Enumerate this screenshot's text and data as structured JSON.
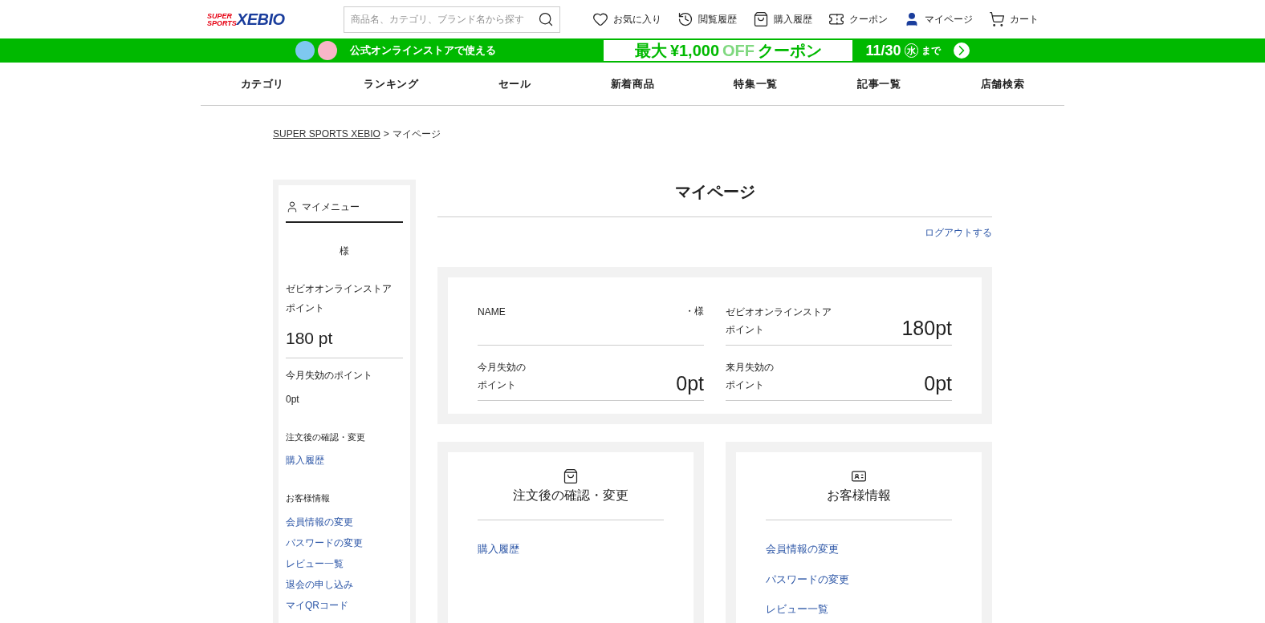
{
  "header": {
    "logo_top": "SUPER",
    "logo_bottom": "SPORTS",
    "logo_brand": "XEBIO",
    "search": {
      "placeholder": "商品名、カテゴリ、ブランド名から探す"
    },
    "links": [
      {
        "kind": "heart",
        "label": "お気に入り"
      },
      {
        "kind": "history",
        "label": "閲覧履歴"
      },
      {
        "kind": "bag",
        "label": "購入履歴"
      },
      {
        "kind": "ticket",
        "label": "クーポン"
      },
      {
        "kind": "user",
        "label": "マイページ"
      },
      {
        "kind": "cart",
        "label": "カート"
      }
    ]
  },
  "banner": {
    "line2": "公式オンラインストアで使える",
    "offer_prefix": "最大",
    "offer_amount": "¥1,000",
    "offer_off": "OFF",
    "offer_suffix": "クーポン",
    "date": "11/30",
    "weekday": "水",
    "until": "まで"
  },
  "nav": [
    "カテゴリ",
    "ランキング",
    "セール",
    "新着商品",
    "特集一覧",
    "記事一覧",
    "店舗検索"
  ],
  "breadcrumb_separator": ">",
  "breadcrumb": [
    {
      "label": "SUPER SPORTS XEBIO",
      "link": true
    },
    {
      "label": "マイページ",
      "link": false
    }
  ],
  "sidebar": {
    "title": "マイメニュー",
    "name_suffix": "様",
    "points_label": "ゼビオオンラインストアポイント",
    "points": "180 pt",
    "expiring_label": "今月失効のポイント",
    "expiring": "0pt",
    "sections": [
      {
        "heading": "注文後の確認・変更",
        "links": [
          "購入履歴"
        ]
      },
      {
        "heading": "お客様情報",
        "links": [
          "会員情報の変更",
          "パスワードの変更",
          "レビュー一覧",
          "退会の申し込み",
          "マイQRコード"
        ]
      }
    ]
  },
  "main": {
    "title": "マイページ",
    "logout": "ログアウトする",
    "summary": [
      {
        "label": "NAME",
        "value": "・様",
        "kind": "name"
      },
      {
        "label": "ゼビオオンラインストアポイント",
        "value": "180pt",
        "kind": "points"
      },
      {
        "label": "今月失効のポイント",
        "value": "0pt",
        "kind": "points"
      },
      {
        "label": "来月失効のポイント",
        "value": "0pt",
        "kind": "points"
      }
    ],
    "cards": [
      {
        "kind": "bag",
        "title": "注文後の確認・変更",
        "links": [
          "購入履歴"
        ]
      },
      {
        "kind": "idcard",
        "title": "お客様情報",
        "links": [
          "会員情報の変更",
          "パスワードの変更",
          "レビュー一覧"
        ]
      }
    ]
  }
}
